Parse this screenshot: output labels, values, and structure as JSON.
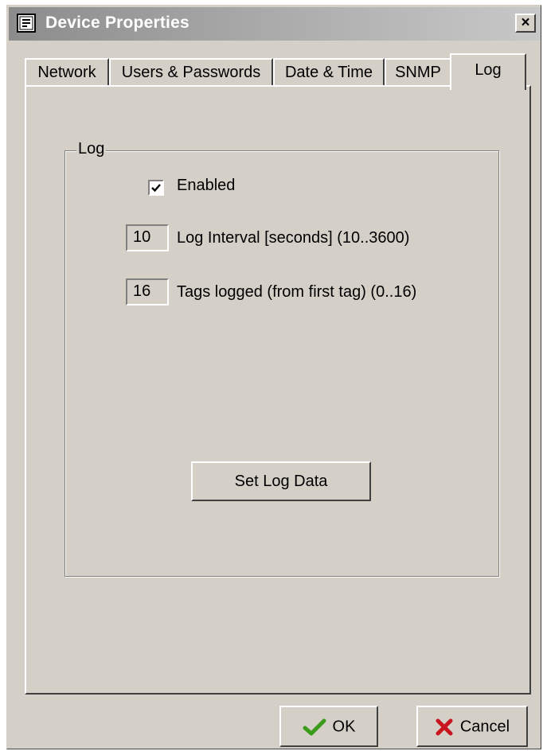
{
  "window": {
    "title": "Device Properties",
    "close_label": "×"
  },
  "tabs": [
    {
      "label": "Network",
      "active": false
    },
    {
      "label": "Users & Passwords",
      "active": false
    },
    {
      "label": "Date & Time",
      "active": false
    },
    {
      "label": "SNMP",
      "active": false
    },
    {
      "label": "Log",
      "active": true
    }
  ],
  "log_group": {
    "title": "Log",
    "enabled": {
      "label": "Enabled",
      "checked": true
    },
    "interval": {
      "value": "10",
      "label": "Log Interval [seconds] (10..3600)"
    },
    "tags": {
      "value": "16",
      "label": "Tags logged (from first tag) (0..16)"
    },
    "set_button_label": "Set Log Data"
  },
  "footer": {
    "ok_label": "OK",
    "cancel_label": "Cancel"
  },
  "colors": {
    "face": "#d4d0c8",
    "ok_icon": "#3a9a1a",
    "cancel_icon": "#c8141e"
  }
}
